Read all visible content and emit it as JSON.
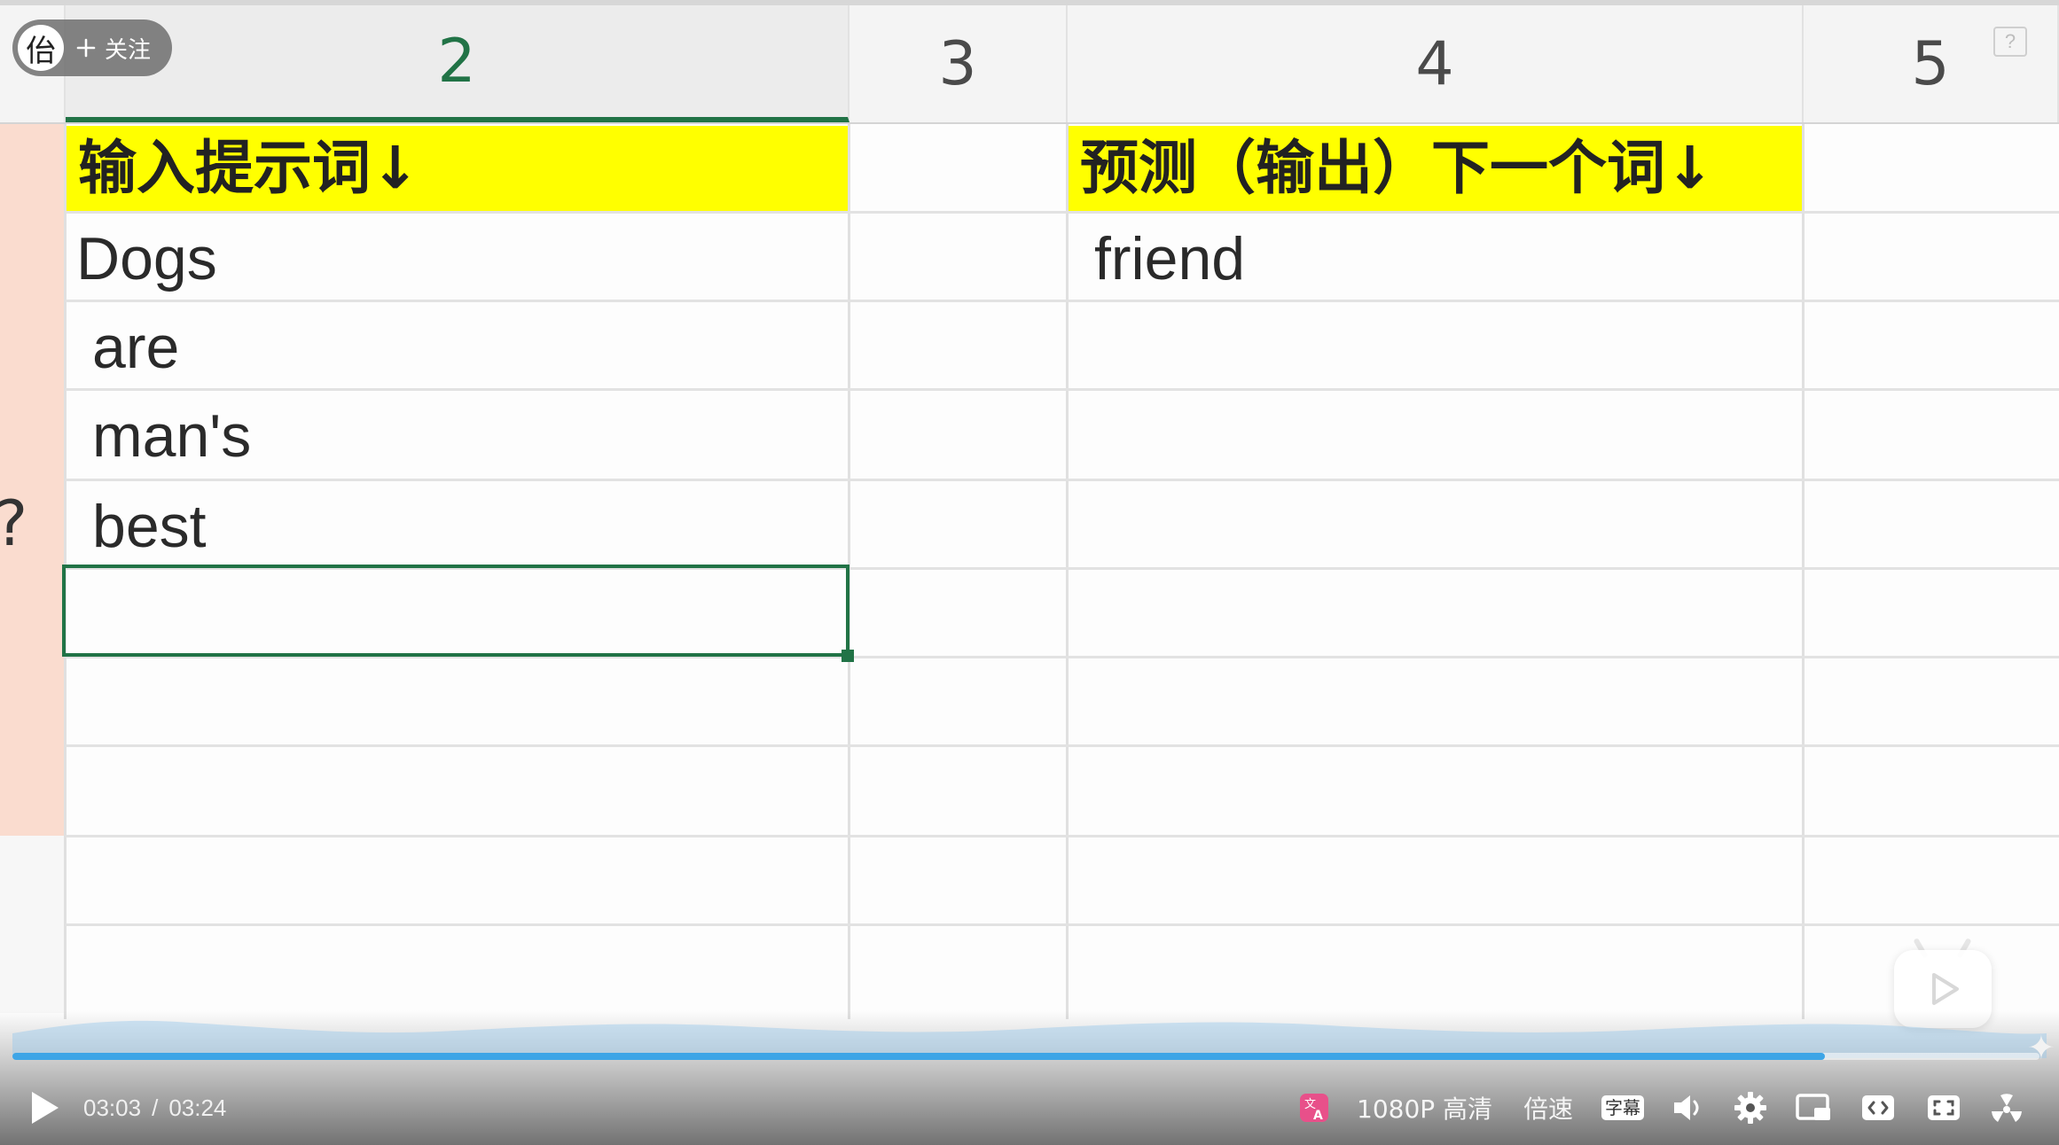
{
  "columns": [
    {
      "label": ""
    },
    {
      "label": "2"
    },
    {
      "label": "3"
    },
    {
      "label": "4"
    },
    {
      "label": "5"
    }
  ],
  "cells": {
    "input_header": "输入提示词↓",
    "output_header": "预测（输出）下一个词↓",
    "inputs": [
      "Dogs",
      "are",
      "man's",
      "best"
    ],
    "output": "friend"
  },
  "overlay": {
    "follow_label": "关注",
    "avatar_glyph": "佁",
    "help_badge": "?"
  },
  "player": {
    "current_time": "03:03",
    "separator": "/",
    "duration": "03:24",
    "progress_fraction": 0.894,
    "quality": "1080P 高清",
    "speed": "倍速",
    "subtitle": "字幕",
    "accent_color": "#3ea5e6"
  }
}
